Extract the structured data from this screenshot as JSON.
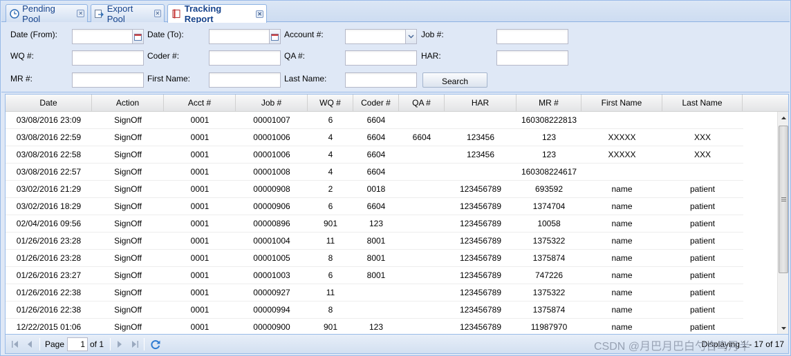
{
  "tabs": [
    {
      "label": "Pending Pool",
      "icon": "clock-icon"
    },
    {
      "label": "Export Pool",
      "icon": "export-icon"
    },
    {
      "label": "Tracking Report",
      "icon": "report-icon"
    }
  ],
  "filter": {
    "date_from_label": "Date (From):",
    "date_to_label": "Date (To):",
    "account_label": "Account #:",
    "job_label": "Job #:",
    "wq_label": "WQ #:",
    "coder_label": "Coder #:",
    "qa_label": "QA #:",
    "har_label": "HAR:",
    "mr_label": "MR #:",
    "first_name_label": "First Name:",
    "last_name_label": "Last Name:",
    "search_label": "Search"
  },
  "columns": [
    "Date",
    "Action",
    "Acct #",
    "Job #",
    "WQ #",
    "Coder #",
    "QA #",
    "HAR",
    "MR #",
    "First Name",
    "Last Name"
  ],
  "rows": [
    [
      "03/08/2016 23:09",
      "SignOff",
      "0001",
      "00001007",
      "6",
      "6604",
      "",
      "",
      "160308222813",
      "",
      ""
    ],
    [
      "03/08/2016 22:59",
      "SignOff",
      "0001",
      "00001006",
      "4",
      "6604",
      "6604",
      "123456",
      "123",
      "XXXXX",
      "XXX"
    ],
    [
      "03/08/2016 22:58",
      "SignOff",
      "0001",
      "00001006",
      "4",
      "6604",
      "",
      "123456",
      "123",
      "XXXXX",
      "XXX"
    ],
    [
      "03/08/2016 22:57",
      "SignOff",
      "0001",
      "00001008",
      "4",
      "6604",
      "",
      "",
      "160308224617",
      "",
      ""
    ],
    [
      "03/02/2016 21:29",
      "SignOff",
      "0001",
      "00000908",
      "2",
      "0018",
      "",
      "123456789",
      "693592",
      "name",
      "patient"
    ],
    [
      "03/02/2016 18:29",
      "SignOff",
      "0001",
      "00000906",
      "6",
      "6604",
      "",
      "123456789",
      "1374704",
      "name",
      "patient"
    ],
    [
      "02/04/2016 09:56",
      "SignOff",
      "0001",
      "00000896",
      "901",
      "123",
      "",
      "123456789",
      "10058",
      "name",
      "patient"
    ],
    [
      "01/26/2016 23:28",
      "SignOff",
      "0001",
      "00001004",
      "11",
      "8001",
      "",
      "123456789",
      "1375322",
      "name",
      "patient"
    ],
    [
      "01/26/2016 23:28",
      "SignOff",
      "0001",
      "00001005",
      "8",
      "8001",
      "",
      "123456789",
      "1375874",
      "name",
      "patient"
    ],
    [
      "01/26/2016 23:27",
      "SignOff",
      "0001",
      "00001003",
      "6",
      "8001",
      "",
      "123456789",
      "747226",
      "name",
      "patient"
    ],
    [
      "01/26/2016 22:38",
      "SignOff",
      "0001",
      "00000927",
      "11",
      "",
      "",
      "123456789",
      "1375322",
      "name",
      "patient"
    ],
    [
      "01/26/2016 22:38",
      "SignOff",
      "0001",
      "00000994",
      "8",
      "",
      "",
      "123456789",
      "1375874",
      "name",
      "patient"
    ],
    [
      "12/22/2015 01:06",
      "SignOff",
      "0001",
      "00000900",
      "901",
      "123",
      "",
      "123456789",
      "11987970",
      "name",
      "patient"
    ]
  ],
  "pager": {
    "page_label": "Page",
    "page_value": "1",
    "of_label": "of 1",
    "display_text": "Displaying 1 - 17 of 17"
  },
  "watermark": "CSDN @月巴月巴白勺合鸟月半"
}
